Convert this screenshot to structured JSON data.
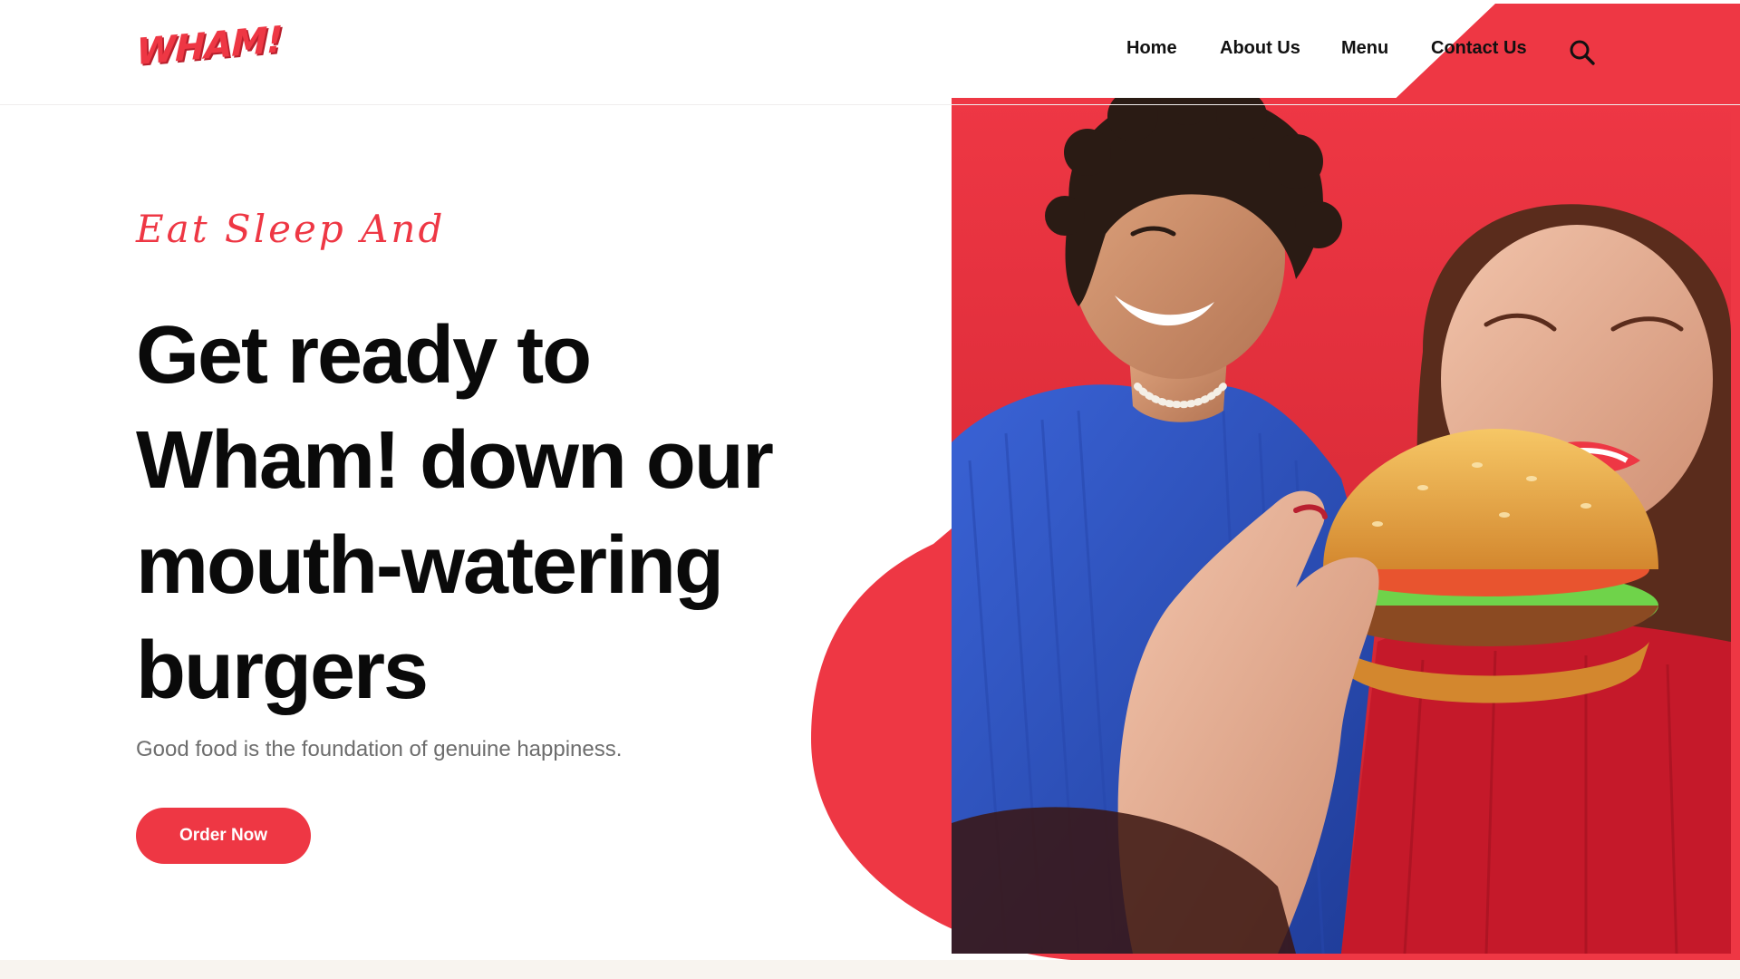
{
  "brand": {
    "logo_text": "WHAM!",
    "accent_color": "#ee3744"
  },
  "nav": {
    "items": [
      {
        "label": "Home"
      },
      {
        "label": "About Us"
      },
      {
        "label": "Menu"
      },
      {
        "label": "Contact Us"
      }
    ],
    "search_icon": "search-icon"
  },
  "hero": {
    "eyebrow": "Eat Sleep And",
    "headline_lines": [
      "Get ready to",
      "Wham! down our",
      "mouth-watering",
      "burgers"
    ],
    "subtitle": "Good food is the foundation of genuine happiness.",
    "cta_label": "Order Now",
    "image": "photo-couple-eating-burger"
  },
  "colors": {
    "accent": "#ee3744",
    "text": "#0a0a0a",
    "muted_text": "#6d6d6d",
    "footer_strip": "#f8f4ef"
  }
}
